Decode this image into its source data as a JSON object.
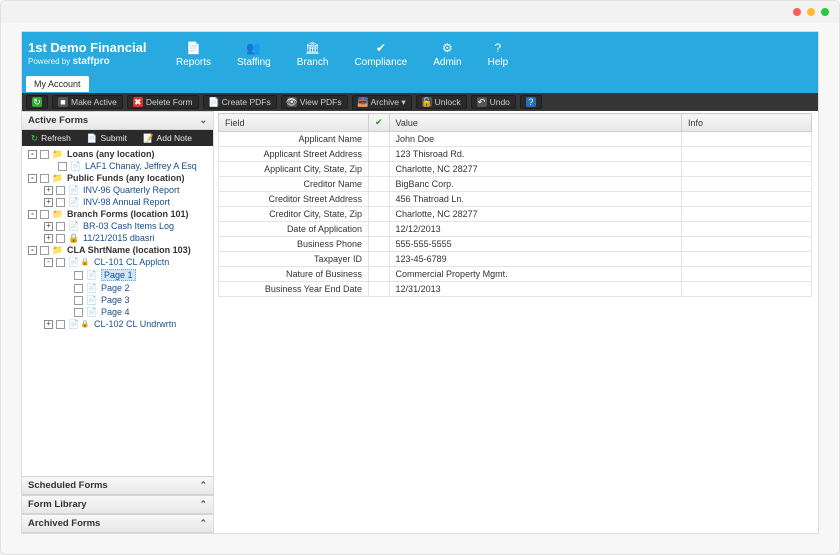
{
  "logo": {
    "title": "1st Demo Financial",
    "powered_prefix": "Powered by ",
    "powered_brand": "staffpro"
  },
  "nav": [
    {
      "icon": "📄",
      "label": "Reports"
    },
    {
      "icon": "👥",
      "label": "Staffing"
    },
    {
      "icon": "🏛",
      "label": "Branch"
    },
    {
      "icon": "✔",
      "label": "Compliance"
    },
    {
      "icon": "⚙",
      "label": "Admin"
    },
    {
      "icon": "?",
      "label": "Help"
    }
  ],
  "account_tab": "My Account",
  "toolbar": [
    {
      "name": "refresh-button",
      "icon": "↻",
      "icon_bg": "#33aa33",
      "label": ""
    },
    {
      "name": "make-active-button",
      "icon": "■",
      "icon_bg": "#555",
      "label": "Make Active"
    },
    {
      "name": "delete-form-button",
      "icon": "✖",
      "icon_bg": "#d33",
      "label": "Delete Form"
    },
    {
      "name": "create-pdfs-button",
      "icon": "📄",
      "icon_bg": "#444",
      "label": "Create PDFs"
    },
    {
      "name": "view-pdfs-button",
      "icon": "👁",
      "icon_bg": "#555",
      "label": "View PDFs"
    },
    {
      "name": "archive-dropdown",
      "icon": "📥",
      "icon_bg": "#2a6db8",
      "label": "Archive ▾"
    },
    {
      "name": "unlock-button",
      "icon": "🔓",
      "icon_bg": "#555",
      "label": "Unlock"
    },
    {
      "name": "undo-button",
      "icon": "↶",
      "icon_bg": "#555",
      "label": "Undo"
    },
    {
      "name": "help-button",
      "icon": "?",
      "icon_bg": "#2a6db8",
      "label": ""
    }
  ],
  "sidebar": {
    "sections": [
      {
        "name": "active-forms",
        "label": "Active Forms",
        "open": true
      },
      {
        "name": "scheduled-forms",
        "label": "Scheduled Forms",
        "open": false
      },
      {
        "name": "form-library",
        "label": "Form Library",
        "open": false
      },
      {
        "name": "archived-forms",
        "label": "Archived Forms",
        "open": false
      }
    ],
    "subtoolbar": {
      "refresh": "Refresh",
      "submit": "Submit",
      "add_note": "Add Note"
    },
    "tree": [
      {
        "d": 1,
        "exp": "-",
        "kind": "folder",
        "label": "Loans (any location)"
      },
      {
        "d": 2,
        "exp": "",
        "kind": "doc",
        "label": "LAF1 Chanay, Jeffrey A Esq"
      },
      {
        "d": 1,
        "exp": "-",
        "kind": "folder",
        "label": "Public Funds (any location)"
      },
      {
        "d": 2,
        "exp": "+",
        "kind": "doc",
        "label": "INV-96 Quarterly Report"
      },
      {
        "d": 2,
        "exp": "+",
        "kind": "doc",
        "label": "INV-98 Annual Report"
      },
      {
        "d": 1,
        "exp": "-",
        "kind": "folder",
        "label": "Branch Forms (location 101)"
      },
      {
        "d": 2,
        "exp": "+",
        "kind": "doc",
        "label": "BR-03 Cash Items Log"
      },
      {
        "d": 2,
        "exp": "+",
        "kind": "lock",
        "label": "11/21/2015 dbasri"
      },
      {
        "d": 1,
        "exp": "-",
        "kind": "folder",
        "label": "CLA ShrtName (location 103)"
      },
      {
        "d": 2,
        "exp": "-",
        "kind": "doclock",
        "label": "CL-101 CL Applctn"
      },
      {
        "d": 3,
        "exp": "",
        "kind": "page",
        "label": "Page 1",
        "selected": true
      },
      {
        "d": 3,
        "exp": "",
        "kind": "page",
        "label": "Page 2"
      },
      {
        "d": 3,
        "exp": "",
        "kind": "page",
        "label": "Page 3"
      },
      {
        "d": 3,
        "exp": "",
        "kind": "page",
        "label": "Page 4"
      },
      {
        "d": 2,
        "exp": "+",
        "kind": "doclock",
        "label": "CL-102 CL Undrwrtn"
      }
    ]
  },
  "grid": {
    "headers": {
      "field": "Field",
      "value": "Value",
      "info": "Info"
    },
    "rows": [
      {
        "field": "Applicant Name",
        "value": "John Doe"
      },
      {
        "field": "Applicant Street Address",
        "value": "123 Thisroad Rd."
      },
      {
        "field": "Applicant City, State, Zip",
        "value": "Charlotte, NC 28277"
      },
      {
        "field": "Creditor Name",
        "value": "BigBanc Corp."
      },
      {
        "field": "Creditor Street Address",
        "value": "456 Thatroad Ln."
      },
      {
        "field": "Creditor City, State, Zip",
        "value": "Charlotte, NC 28277"
      },
      {
        "field": "Date of Application",
        "value": "12/12/2013"
      },
      {
        "field": "Business Phone",
        "value": "555-555-5555"
      },
      {
        "field": "Taxpayer ID",
        "value": "123-45-6789"
      },
      {
        "field": "Nature of Business",
        "value": "Commercial Property Mgmt."
      },
      {
        "field": "Business Year End Date",
        "value": "12/31/2013"
      }
    ]
  },
  "colors": {
    "accent": "#28aae1",
    "dark": "#363636"
  }
}
